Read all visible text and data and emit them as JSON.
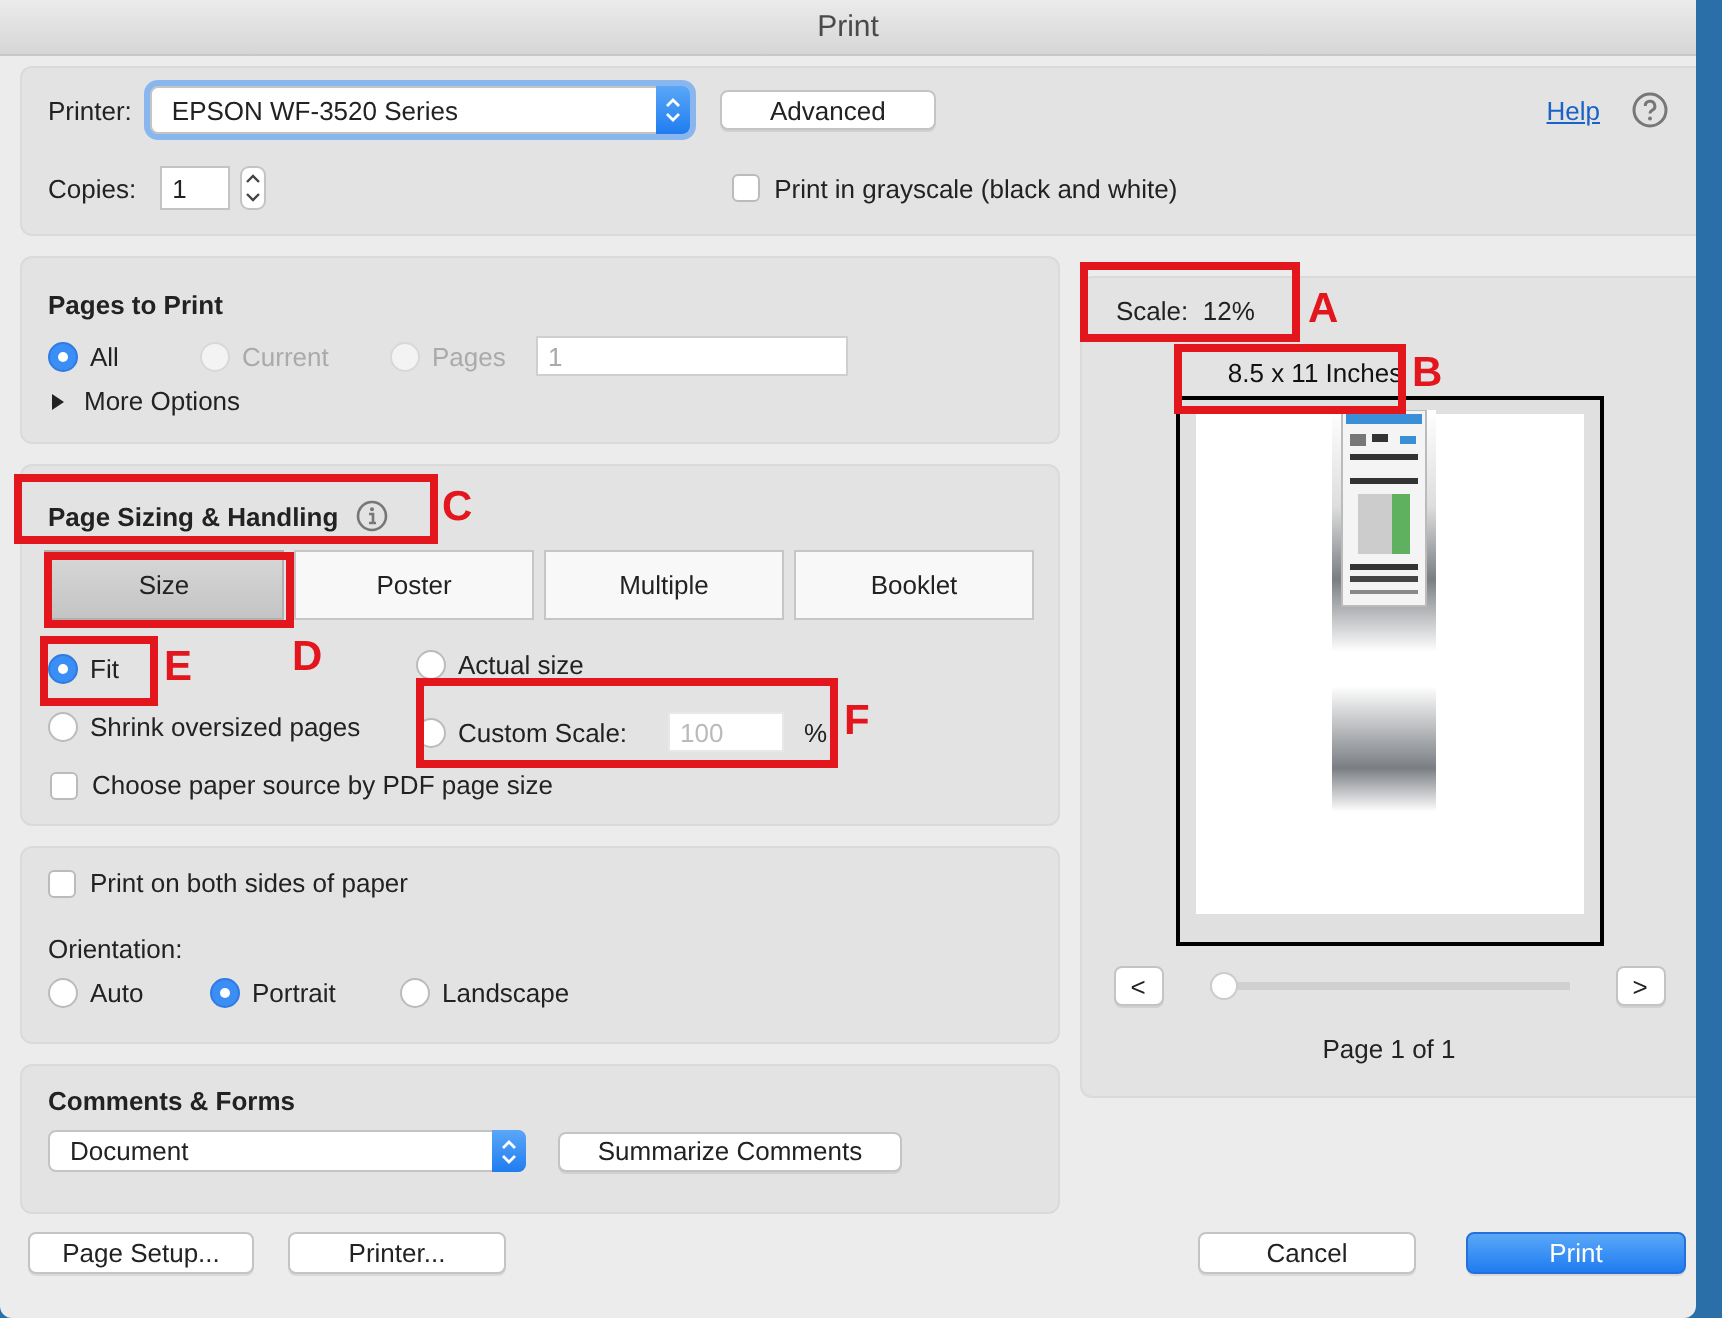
{
  "window": {
    "title": "Print"
  },
  "printer": {
    "label": "Printer:",
    "value": "EPSON WF-3520 Series",
    "advanced_button": "Advanced",
    "help_link": "Help",
    "copies_label": "Copies:",
    "copies": "1",
    "grayscale": {
      "label": "Print in grayscale (black and white)",
      "checked": false
    }
  },
  "pages_to_print": {
    "title": "Pages to Print",
    "options": [
      {
        "label": "All",
        "selected": true,
        "disabled": false
      },
      {
        "label": "Current",
        "selected": false,
        "disabled": true
      },
      {
        "label": "Pages",
        "selected": false,
        "disabled": true
      }
    ],
    "pages_value": "1",
    "more_options": "More Options",
    "expanded": false
  },
  "page_sizing": {
    "title": "Page Sizing & Handling",
    "tabs": [
      {
        "label": "Size",
        "selected": true
      },
      {
        "label": "Poster",
        "selected": false
      },
      {
        "label": "Multiple",
        "selected": false
      },
      {
        "label": "Booklet",
        "selected": false
      }
    ],
    "options": [
      {
        "label": "Fit",
        "selected": true
      },
      {
        "label": "Actual size",
        "selected": false
      },
      {
        "label": "Shrink oversized pages",
        "selected": false
      },
      {
        "label": "Custom Scale:",
        "selected": false
      }
    ],
    "custom_scale_placeholder": "100",
    "percent": "%",
    "paper_source": {
      "label": "Choose paper source by PDF page size",
      "checked": false
    }
  },
  "layout": {
    "duplex": {
      "label": "Print on both sides of paper",
      "checked": false
    },
    "orientation_label": "Orientation:",
    "orientation": [
      {
        "label": "Auto",
        "selected": false
      },
      {
        "label": "Portrait",
        "selected": true
      },
      {
        "label": "Landscape",
        "selected": false
      }
    ]
  },
  "comments_forms": {
    "title": "Comments & Forms",
    "value": "Document",
    "summarize_button": "Summarize Comments"
  },
  "preview": {
    "scale": "Scale:  12%",
    "paper_size": "8.5 x 11 Inches",
    "prev_button": "<",
    "next_button": ">",
    "page_slider": {
      "level": 0
    },
    "page_label": "Page 1 of 1"
  },
  "footer_buttons": [
    {
      "label": "Page Setup...",
      "kind": "plain"
    },
    {
      "label": "Printer...",
      "kind": "plain"
    },
    {
      "label": "Cancel",
      "kind": "plain"
    },
    {
      "label": "Print",
      "kind": "default"
    }
  ],
  "annotations": [
    {
      "label": "A"
    },
    {
      "label": "B"
    },
    {
      "label": "C"
    },
    {
      "label": "D"
    },
    {
      "label": "E"
    },
    {
      "label": "F"
    }
  ]
}
